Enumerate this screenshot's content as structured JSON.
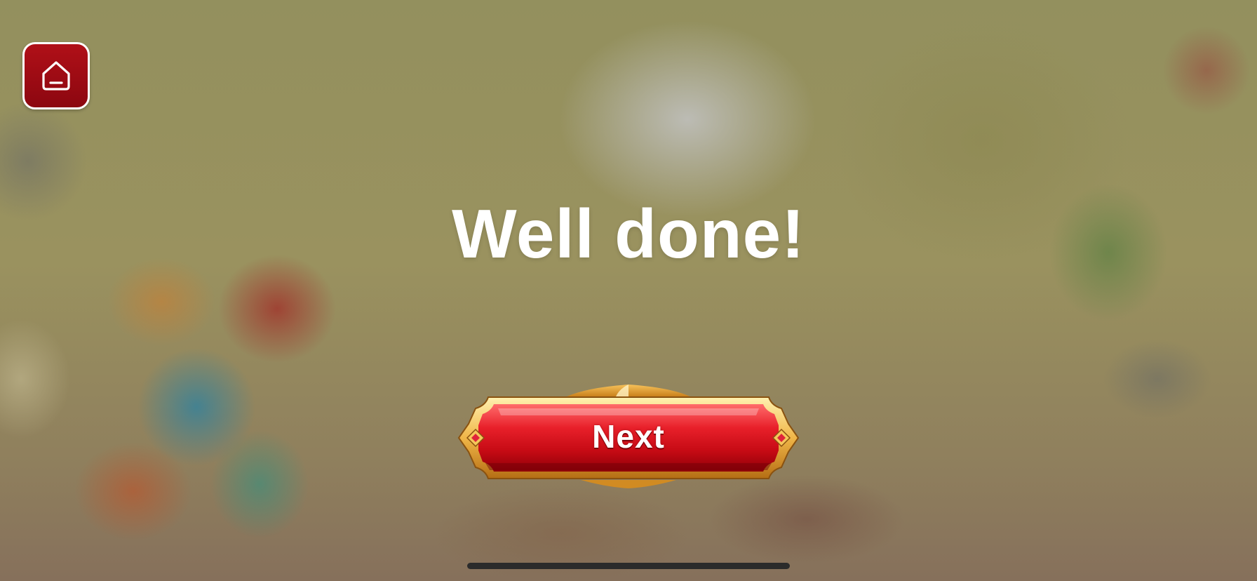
{
  "headline": "Well done!",
  "next_button": {
    "label": "Next"
  },
  "home_button": {
    "icon": "home-icon"
  },
  "colors": {
    "button_red": "#d8141e",
    "button_gold": "#e8a83a",
    "home_red": "#a00c14",
    "text_white": "#ffffff"
  }
}
